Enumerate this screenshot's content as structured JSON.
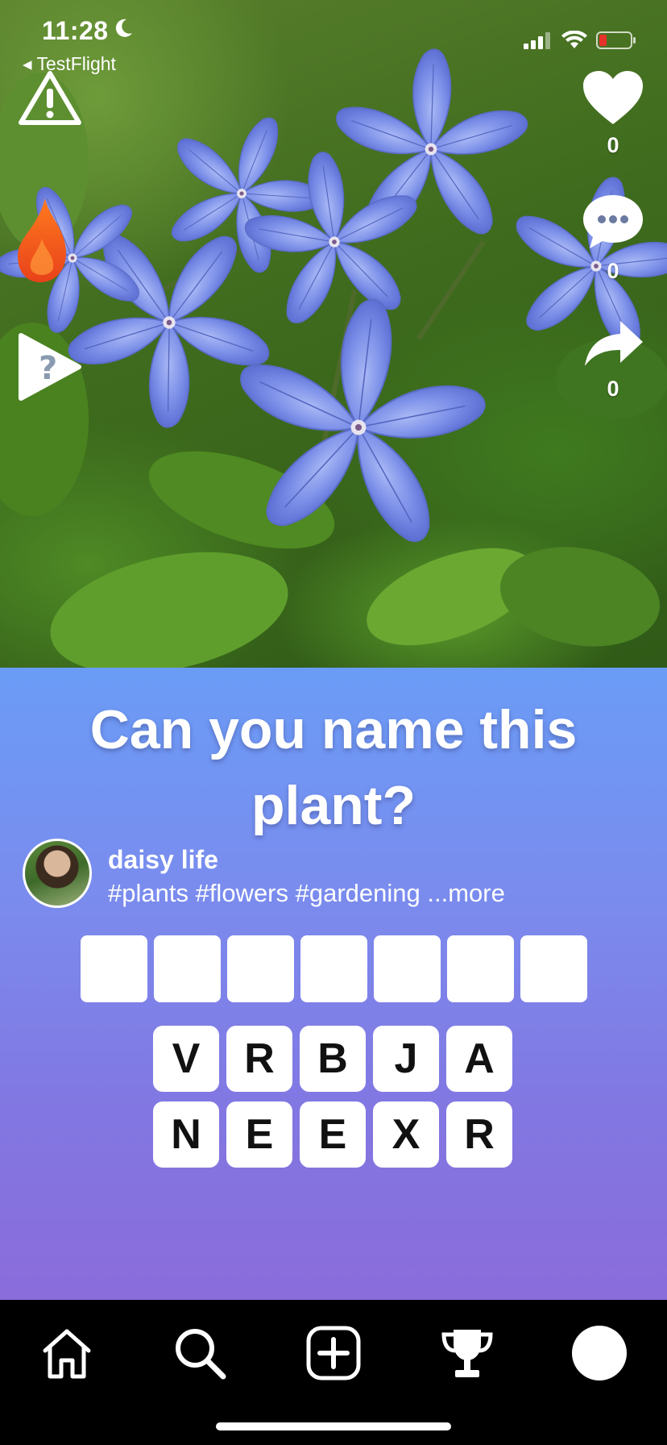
{
  "status_bar": {
    "time": "11:28",
    "focus_icon": "moon-icon",
    "back_app": "◂ TestFlight",
    "icons": [
      "cellular-signal-icon",
      "wifi-icon",
      "battery-low-icon"
    ]
  },
  "overlay_left": {
    "icons": [
      "warning-triangle-icon",
      "streak-flame-icon",
      "quiz-play-icon"
    ]
  },
  "overlay_right": {
    "like": {
      "icon": "heart-icon",
      "count": "0"
    },
    "comment": {
      "icon": "comment-bubble-icon",
      "count": "0"
    },
    "share": {
      "icon": "share-arrow-icon",
      "count": "0"
    }
  },
  "post": {
    "question": "Can you name this plant?",
    "author_name": "daisy life",
    "tags_text": "#plants #flowers #gardening ...more",
    "answer_slots": 7,
    "letter_rows": [
      [
        "V",
        "R",
        "B",
        "J",
        "A"
      ],
      [
        "N",
        "E",
        "E",
        "X",
        "R"
      ]
    ]
  },
  "tab_bar": {
    "tabs": [
      "home-icon",
      "search-icon",
      "create-post-icon",
      "trophy-icon",
      "profile-avatar-icon"
    ]
  },
  "colors": {
    "panel_top": "#6a9cf6",
    "panel_bottom": "#8a6cdb",
    "flame": "#f05a1a",
    "battery_low": "#e5322b"
  }
}
